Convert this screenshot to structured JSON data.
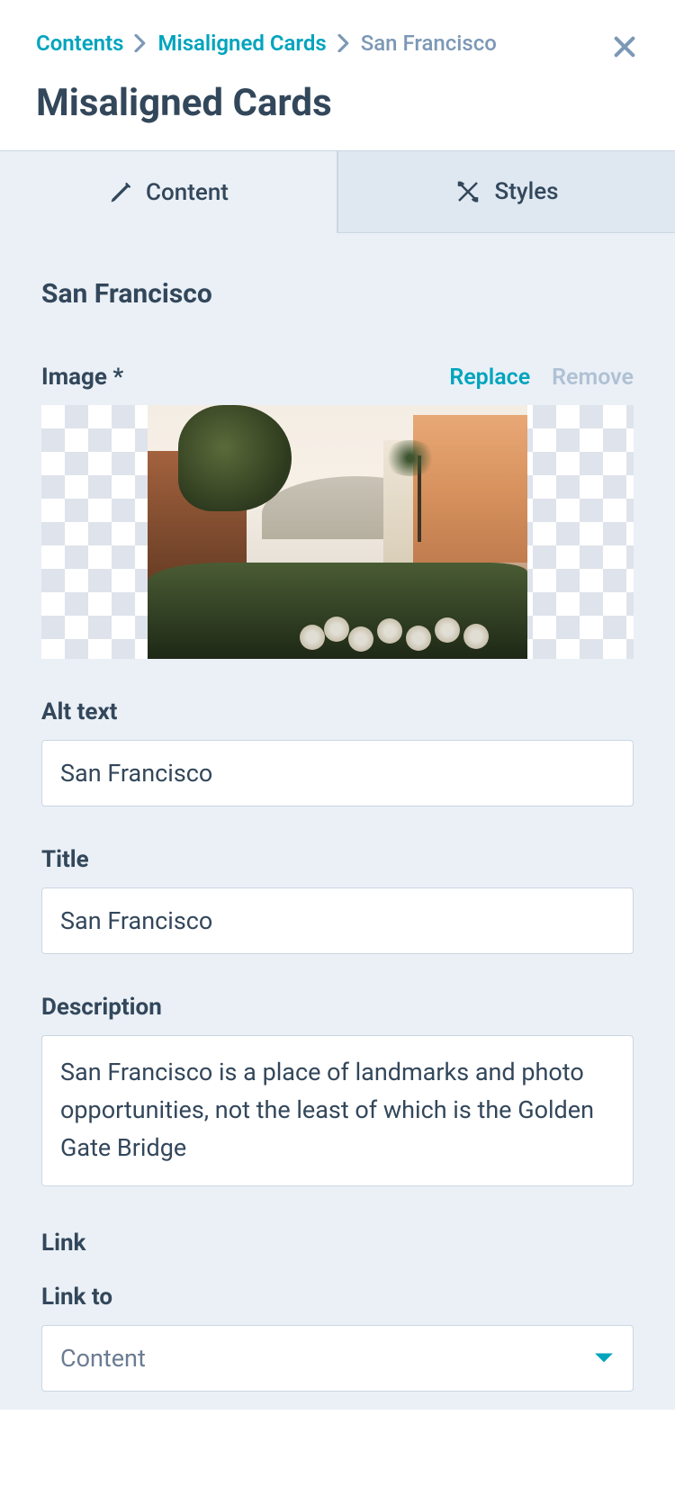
{
  "breadcrumb": {
    "items": [
      "Contents",
      "Misaligned Cards",
      "San Francisco"
    ]
  },
  "page_title": "Misaligned Cards",
  "tabs": {
    "content_label": "Content",
    "styles_label": "Styles"
  },
  "editor": {
    "heading": "San Francisco",
    "image": {
      "label": "Image *",
      "replace": "Replace",
      "remove": "Remove"
    },
    "alt_text": {
      "label": "Alt text",
      "value": "San Francisco"
    },
    "title": {
      "label": "Title",
      "value": "San Francisco"
    },
    "description": {
      "label": "Description",
      "value": "San Francisco is a place of landmarks and photo opportunities, not the least of which is the Golden Gate Bridge"
    },
    "link": {
      "heading": "Link",
      "link_to_label": "Link to",
      "link_to_value": "Content"
    }
  }
}
